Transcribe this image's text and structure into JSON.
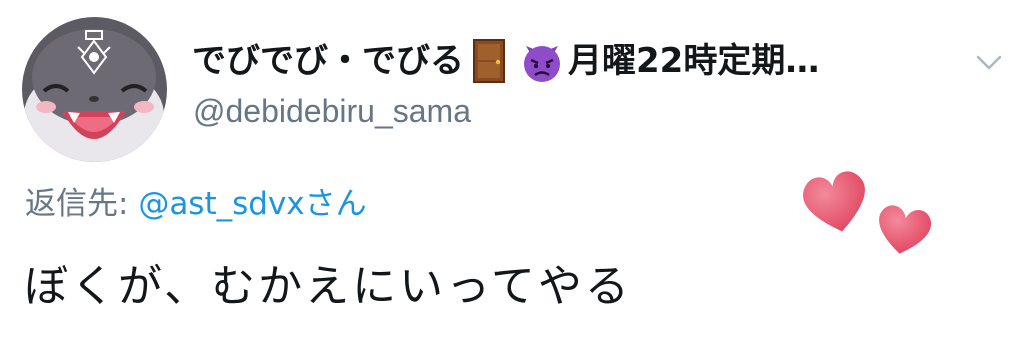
{
  "user": {
    "display_name_part1": "でびでび・でびる",
    "display_name_part2": "月曜22時定期…",
    "handle": "@debidebiru_sama",
    "emoji_1": "door-emoji",
    "emoji_2": "angry-devil-emoji"
  },
  "reply": {
    "label": "返信先: ",
    "target": "@ast_sdvxさん"
  },
  "tweet": {
    "text": "ぼくが、むかえにいってやる"
  },
  "icons": {
    "menu": "chevron-down-icon",
    "decoration": "two-hearts-emoji"
  },
  "colors": {
    "secondary_text": "#657786",
    "link": "#1b95e0",
    "primary_text": "#14171a",
    "heart": "#e8546e"
  }
}
